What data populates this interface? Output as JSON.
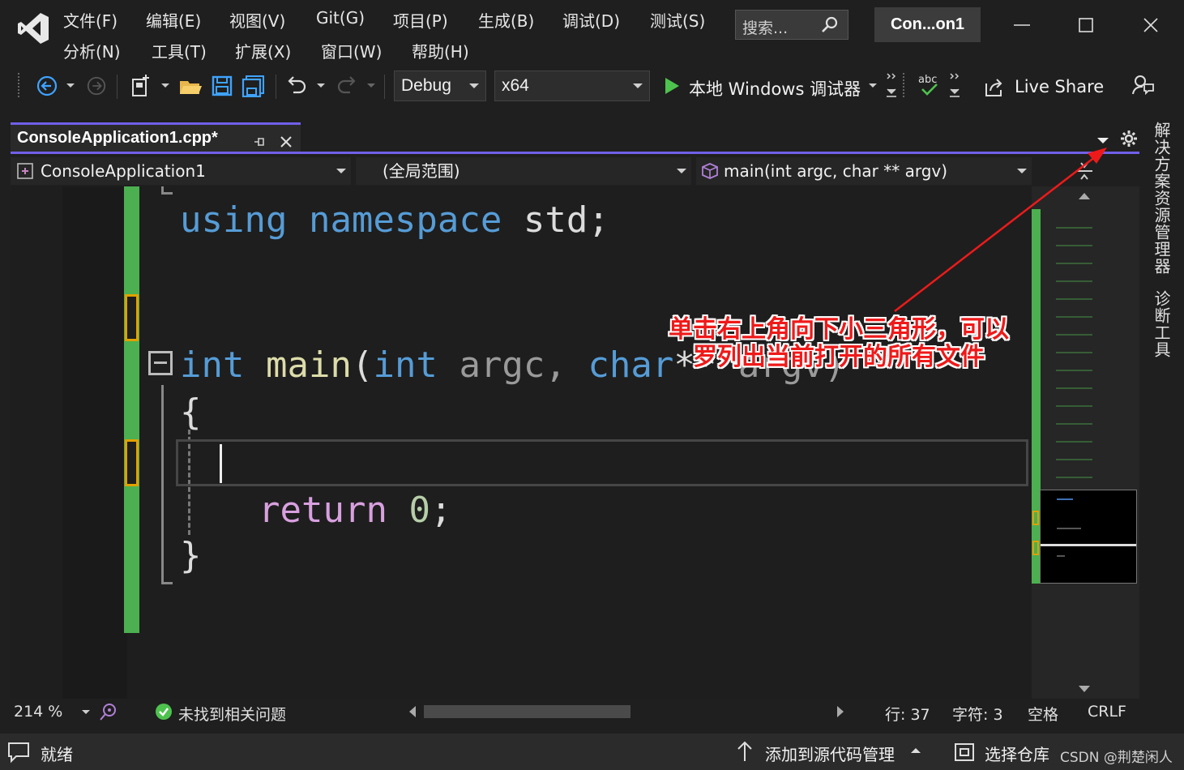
{
  "menu": {
    "row1": [
      "文件(F)",
      "编辑(E)",
      "视图(V)",
      "Git(G)",
      "项目(P)",
      "生成(B)",
      "调试(D)",
      "测试(S)"
    ],
    "row2": [
      "分析(N)",
      "工具(T)",
      "扩展(X)",
      "窗口(W)",
      "帮助(H)"
    ]
  },
  "search": {
    "placeholder": "搜索..."
  },
  "solution_badge": "Con...on1",
  "toolbar": {
    "configuration": "Debug",
    "platform": "x64",
    "debugger_label": "本地 Windows 调试器",
    "live_share": "Live Share"
  },
  "tab": {
    "name": "ConsoleApplication1.cpp*"
  },
  "navbar": {
    "project": "ConsoleApplication1",
    "scope": "(全局范围)",
    "member": "main(int argc, char ** argv)"
  },
  "code": {
    "line1": [
      "using",
      "namespace",
      "std;"
    ],
    "line2": [
      "int",
      "main",
      "(",
      "int",
      "argc,",
      "char",
      "**",
      "argv)"
    ],
    "brace_open": "{",
    "return_kw": "return",
    "return_val": "0",
    "semi": ";",
    "brace_close": "}"
  },
  "editor_status": {
    "zoom": "214 %",
    "issues": "未找到相关问题",
    "line": "行: 37",
    "char": "字符: 3",
    "whitespace": "空格",
    "line_ending": "CRLF"
  },
  "statusbar": {
    "ready": "就绪",
    "source_control": "添加到源代码管理",
    "repo": "选择仓库",
    "watermark": "CSDN @荆楚闲人"
  },
  "side_tabs": [
    "解决方案资源管理器",
    "诊断工具"
  ],
  "annotation": {
    "line1": "单击右上角向下小三角形，可以",
    "line2": "罗列出当前打开的所有文件"
  },
  "colors": {
    "accent": "#7160e8",
    "green_margin": "#4caf50",
    "annotation_red": "#ee1a1a"
  }
}
